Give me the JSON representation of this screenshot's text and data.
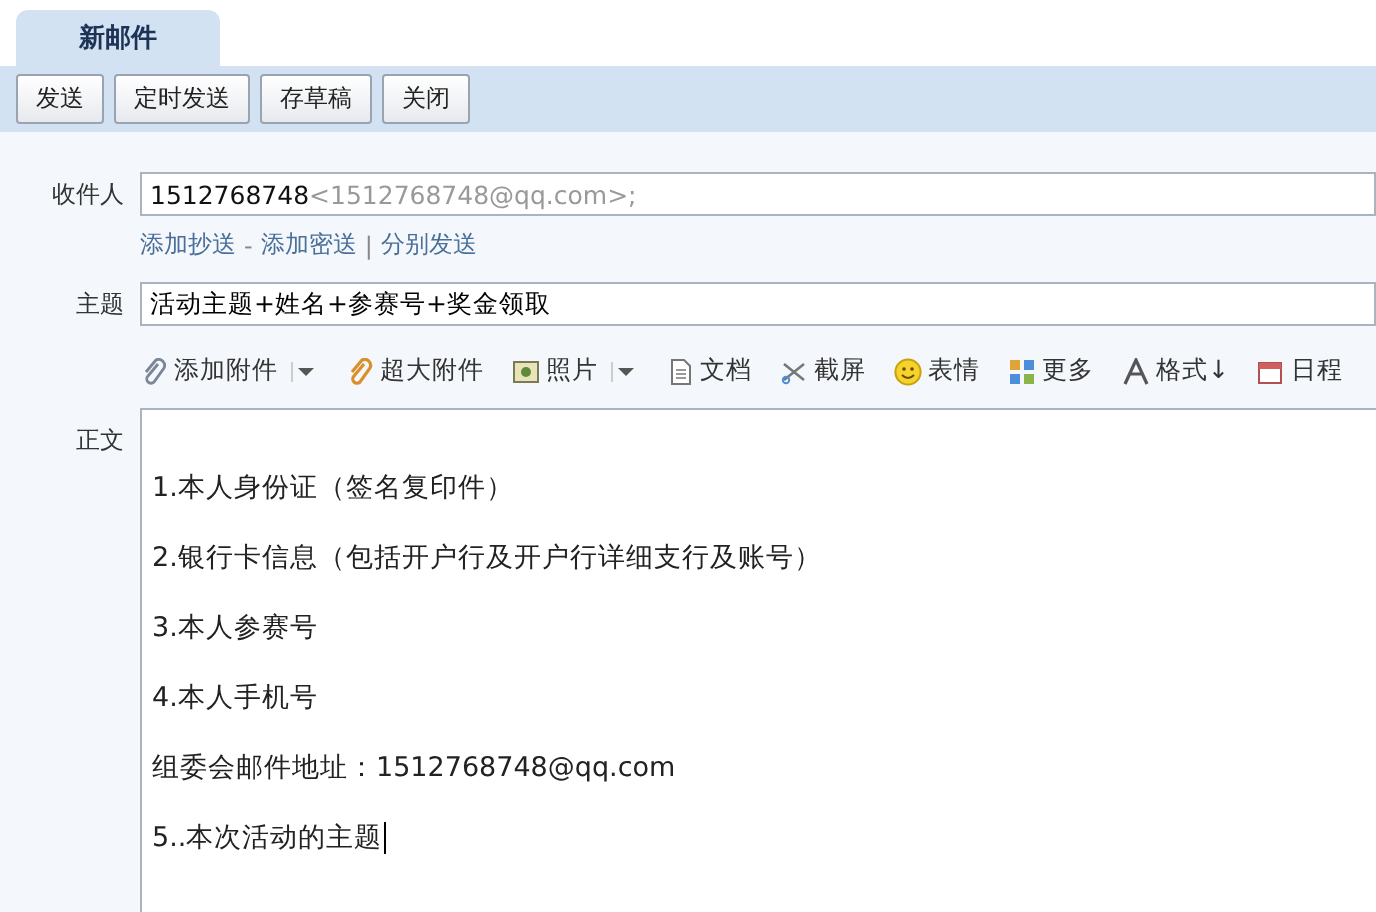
{
  "tabs": [
    {
      "label": "新邮件",
      "selected": true
    }
  ],
  "actions": [
    "发送",
    "定时发送",
    "存草稿",
    "关闭"
  ],
  "recipient": {
    "label": "收件人",
    "name": "1512768748",
    "address": "<1512768748@qq.com>;"
  },
  "recipient_links": [
    {
      "label": "添加抄送",
      "separator": "-"
    },
    {
      "label": "添加密送",
      "separator": "|"
    },
    {
      "label": "分别发送"
    }
  ],
  "subject": {
    "label": "主题",
    "value": "活动主题+姓名+参赛号+奖金领取"
  },
  "editor_tools": [
    {
      "kind": "attach",
      "label": "添加附件",
      "dropdown": true
    },
    {
      "kind": "bigattach",
      "label": "超大附件",
      "dropdown": false
    },
    {
      "kind": "photo",
      "label": "照片",
      "dropdown": true
    },
    {
      "kind": "doc",
      "label": "文档",
      "dropdown": false
    },
    {
      "kind": "screenshot",
      "label": "截屏",
      "dropdown": false
    },
    {
      "kind": "emoji",
      "label": "表情",
      "dropdown": false
    },
    {
      "kind": "more",
      "label": "更多",
      "dropdown": false
    },
    {
      "kind": "format",
      "label": "格式↓",
      "dropdown": false
    },
    {
      "kind": "calendar",
      "label": "日程",
      "dropdown": false
    }
  ],
  "body": {
    "label": "正文",
    "lines": [
      "1.本人身份证（签名复印件）",
      "2.银行卡信息（包括开户行及开户行详细支行及账号）",
      "3.本人参赛号",
      "4.本人手机号",
      "组委会邮件地址：1512768748@qq.com",
      "5..本次活动的主题"
    ]
  }
}
